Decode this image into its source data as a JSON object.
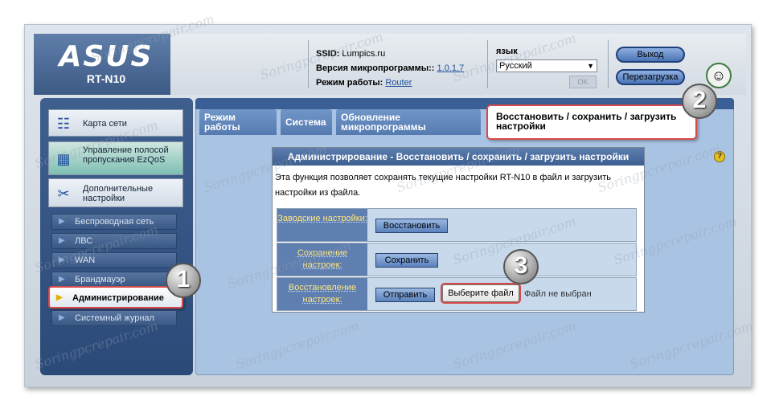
{
  "header": {
    "brand": "ASUS",
    "model": "RT-N10",
    "ssid_label": "SSID:",
    "ssid_value": "Lumpics.ru",
    "firmware_label": "Версия микропрограммы::",
    "firmware_value": "1.0.1.7",
    "mode_label": "Режим работы:",
    "mode_value": "Router",
    "language_label": "язык",
    "language_value": "Русский",
    "language_apply": "OK",
    "logout_label": "Выход",
    "reboot_label": "Перезагрузка"
  },
  "sidebar": {
    "big_items": [
      {
        "label": "Карта сети"
      },
      {
        "label": "Управление полосой пропускания EzQoS"
      },
      {
        "label": "Дополнительные настройки"
      }
    ],
    "sub_items": [
      {
        "label": "Беспроводная сеть"
      },
      {
        "label": "ЛВС"
      },
      {
        "label": "WAN"
      },
      {
        "label": "Брандмауэр"
      },
      {
        "label": "Администрирование"
      },
      {
        "label": "Системный журнал"
      }
    ]
  },
  "tabs": [
    {
      "label": "Режим работы"
    },
    {
      "label": "Система"
    },
    {
      "label": "Обновление микропрограммы"
    },
    {
      "label": "Восстановить / сохранить / загрузить настройки"
    }
  ],
  "panel": {
    "title": "Администрирование - Восстановить / сохранить / загрузить настройки",
    "description": "Эта функция позволяет сохранять текущие настройки RT-N10 в файл и загрузить настройки из файла.",
    "rows": [
      {
        "label": "Заводские настройки:",
        "button": "Восстановить"
      },
      {
        "label": "Сохранение настроек:",
        "button": "Сохранить"
      },
      {
        "label": "Восстановление настроек:",
        "button": "Отправить",
        "file_button": "Выберите файл",
        "file_status": "Файл не выбран"
      }
    ]
  },
  "badges": [
    "1",
    "2",
    "3"
  ],
  "watermark": "Soringpcrepair.com",
  "colors": {
    "sidebar": "#2b4a78",
    "content_bg": "#a9c3e3",
    "highlight": "#d54a4a",
    "label_text": "#ffe680"
  }
}
